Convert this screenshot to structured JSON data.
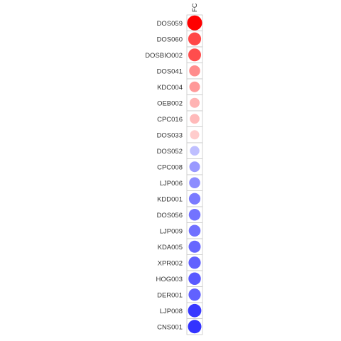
{
  "chart_data": {
    "type": "heatmap",
    "columns": [
      "FC"
    ],
    "rows": [
      "DOS059",
      "DOS060",
      "DOSBIO002",
      "DOS041",
      "KDC004",
      "OEB002",
      "CPC016",
      "DOS033",
      "DOS052",
      "CPC008",
      "LJP006",
      "KDD001",
      "DOS056",
      "LJP009",
      "KDA005",
      "XPR002",
      "HOG003",
      "DER001",
      "LJP008",
      "CNS001"
    ],
    "values": [
      1.0,
      0.72,
      0.7,
      0.45,
      0.4,
      0.3,
      0.27,
      0.2,
      -0.25,
      -0.4,
      -0.45,
      -0.52,
      -0.55,
      -0.56,
      -0.6,
      -0.62,
      -0.65,
      -0.62,
      -0.78,
      -0.8
    ],
    "color_scale": {
      "positive": "#ff0000",
      "negative": "#0000ff",
      "zero": "#ffffff"
    },
    "legend": "none",
    "grid": true
  }
}
